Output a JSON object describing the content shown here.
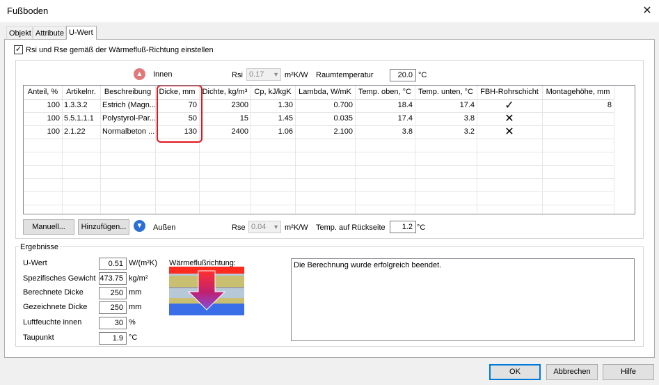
{
  "window": {
    "title": "Fußboden"
  },
  "tabs": [
    {
      "label": "Objekt"
    },
    {
      "label": "Attribute"
    },
    {
      "label": "U-Wert"
    }
  ],
  "rsi_checkbox": {
    "label": "Rsi und Rse gemäß der Wärmefluß-Richtung einstellen",
    "checked": true
  },
  "top_row": {
    "innen_label": "Innen",
    "rsi_label": "Rsi",
    "rsi_value": "0.17",
    "rsi_unit": "m²K/W",
    "raumtemp_label": "Raumtemperatur",
    "raumtemp_value": "20.0",
    "raumtemp_unit": "°C"
  },
  "table": {
    "columns": [
      "Anteil, %",
      "Artikelnr.",
      "Beschreibung",
      "Dicke, mm",
      "Dichte, kg/m³",
      "Cp, kJ/kgK",
      "Lambda, W/mK",
      "Temp. oben, °C",
      "Temp. unten, °C",
      "FBH-Rohrschicht",
      "Montagehöhe, mm"
    ],
    "rows": [
      {
        "anteil": "100",
        "artikel": "1.3.3.2",
        "beschreibung": "Estrich (Magn...",
        "dicke": "70",
        "dichte": "2300",
        "cp": "1.30",
        "lambda": "0.700",
        "temp_oben": "18.4",
        "temp_unten": "17.4",
        "fbh": "✓",
        "montage": "8"
      },
      {
        "anteil": "100",
        "artikel": "5.5.1.1.1",
        "beschreibung": "Polystyrol-Par...",
        "dicke": "50",
        "dichte": "15",
        "cp": "1.45",
        "lambda": "0.035",
        "temp_oben": "17.4",
        "temp_unten": "3.8",
        "fbh": "✕",
        "montage": ""
      },
      {
        "anteil": "100",
        "artikel": "2.1.22",
        "beschreibung": "Normalbeton ...",
        "dicke": "130",
        "dichte": "2400",
        "cp": "1.06",
        "lambda": "2.100",
        "temp_oben": "3.8",
        "temp_unten": "3.2",
        "fbh": "✕",
        "montage": ""
      }
    ]
  },
  "bottom_row": {
    "manuell_label": "Manuell...",
    "hinzufuegen_label": "Hinzufügen...",
    "aussen_label": "Außen",
    "rse_label": "Rse",
    "rse_value": "0.04",
    "rse_unit": "m²K/W",
    "temp_rueck_label": "Temp. auf Rückseite",
    "temp_rueck_value": "1.2",
    "temp_rueck_unit": "°C"
  },
  "ergebnisse": {
    "title": "Ergebnisse",
    "fields": [
      {
        "label": "U-Wert",
        "value": "0.51",
        "unit": "W/(m²K)"
      },
      {
        "label": "Spezifisches Gewicht",
        "value": "473.75",
        "unit": "kg/m²"
      },
      {
        "label": "Berechnete Dicke",
        "value": "250",
        "unit": "mm"
      },
      {
        "label": "Gezeichnete Dicke",
        "value": "250",
        "unit": "mm"
      },
      {
        "label": "Luftfeuchte innen",
        "value": "30",
        "unit": "%"
      },
      {
        "label": "Taupunkt",
        "value": "1.9",
        "unit": "°C"
      }
    ],
    "waermefluss_label": "Wärmeflußrichtung:",
    "message": "Die Berechnung wurde erfolgreich beendet."
  },
  "footer": {
    "ok_label": "OK",
    "abbrechen_label": "Abbrechen",
    "hilfe_label": "Hilfe"
  },
  "colors": {
    "highlight_border": "#e0141e",
    "primary_button": "#0078d7"
  },
  "icons": {
    "up": "arrow-up-icon",
    "down": "arrow-down-icon"
  }
}
